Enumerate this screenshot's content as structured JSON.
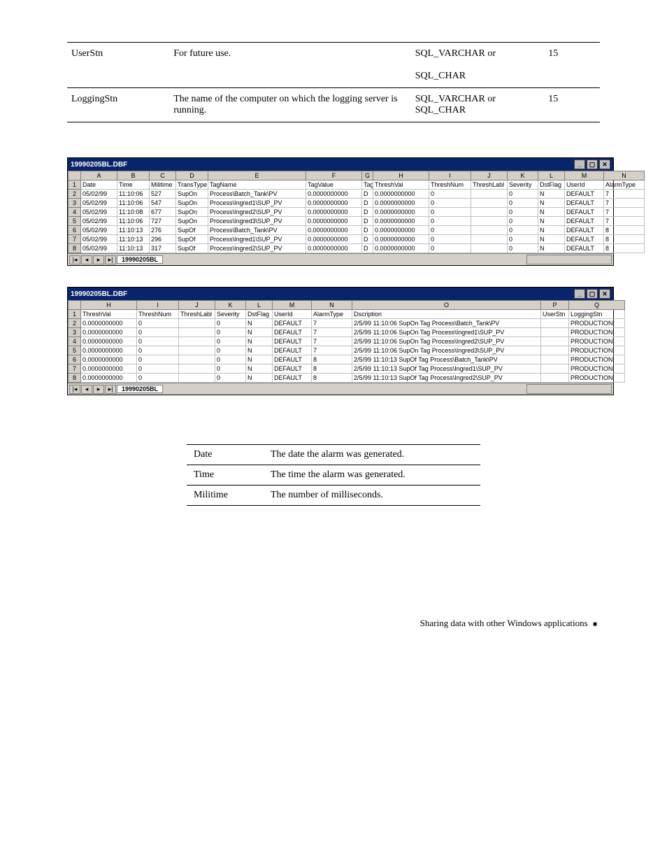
{
  "doc_table_top": {
    "rows": [
      {
        "name": "UserStn",
        "desc": "For future use.",
        "type": "SQL_VARCHAR or\n\nSQL_CHAR",
        "len": "15"
      },
      {
        "name": "LoggingStn",
        "desc": "The name of the computer on which the logging server is running.",
        "type": "SQL_VARCHAR or SQL_CHAR",
        "len": "15"
      }
    ]
  },
  "spreadsheet1": {
    "title": "19990205BL.DBF",
    "col_letters": [
      "",
      "A",
      "B",
      "C",
      "D",
      "E",
      "F",
      "G",
      "H",
      "I",
      "J",
      "K",
      "L",
      "M",
      "N"
    ],
    "header_row": [
      "1",
      "Date",
      "Time",
      "Militime",
      "TransType",
      "TagName",
      "TagValue",
      "TagType",
      "ThreshVal",
      "ThreshNum",
      "ThreshLabl",
      "Severity",
      "DstFlag",
      "UserId",
      "AlarmType"
    ],
    "rows": [
      [
        "2",
        "05/02/99",
        "11:10:06",
        "527",
        "SupOn",
        "Process\\Batch_Tank\\PV",
        "0.0000000000",
        "D",
        "0.0000000000",
        "0",
        "",
        "0",
        "N",
        "DEFAULT",
        "7"
      ],
      [
        "3",
        "05/02/99",
        "11:10:06",
        "547",
        "SupOn",
        "Process\\Ingred1\\SUP_PV",
        "0.0000000000",
        "D",
        "0.0000000000",
        "0",
        "",
        "0",
        "N",
        "DEFAULT",
        "7"
      ],
      [
        "4",
        "05/02/99",
        "11:10:08",
        "677",
        "SupOn",
        "Process\\Ingred2\\SUP_PV",
        "0.0000000000",
        "D",
        "0.0000000000",
        "0",
        "",
        "0",
        "N",
        "DEFAULT",
        "7"
      ],
      [
        "5",
        "05/02/99",
        "11:10:06",
        "727",
        "SupOn",
        "Process\\Ingred3\\SUP_PV",
        "0.0000000000",
        "D",
        "0.0000000000",
        "0",
        "",
        "0",
        "N",
        "DEFAULT",
        "7"
      ],
      [
        "6",
        "05/02/99",
        "11:10:13",
        "276",
        "SupOf",
        "Process\\Batch_Tank\\PV",
        "0.0000000000",
        "D",
        "0.0000000000",
        "0",
        "",
        "0",
        "N",
        "DEFAULT",
        "8"
      ],
      [
        "7",
        "05/02/99",
        "11:10:13",
        "296",
        "SupOf",
        "Process\\Ingred1\\SUP_PV",
        "0.0000000000",
        "D",
        "0.0000000000",
        "0",
        "",
        "0",
        "N",
        "DEFAULT",
        "8"
      ],
      [
        "8",
        "05/02/99",
        "11:10:13",
        "317",
        "SupOf",
        "Process\\Ingred2\\SUP_PV",
        "0.0000000000",
        "D",
        "0.0000000000",
        "0",
        "",
        "0",
        "N",
        "DEFAULT",
        "8"
      ]
    ],
    "tab": "19990205BL"
  },
  "spreadsheet2": {
    "title": "19990205BL.DBF",
    "col_letters": [
      "",
      "H",
      "I",
      "J",
      "K",
      "L",
      "M",
      "N",
      "O",
      "P",
      "Q"
    ],
    "header_row": [
      "1",
      "ThreshVal",
      "ThreshNum",
      "ThreshLabl",
      "Severity",
      "DstFlag",
      "UserId",
      "AlarmType",
      "Dscription",
      "UserStn",
      "LoggingStn"
    ],
    "rows": [
      [
        "2",
        "0.0000000000",
        "0",
        "",
        "0",
        "N",
        "DEFAULT",
        "7",
        "2/5/99     11:10:06 SupOn Tag Process\\Batch_Tank\\PV",
        "",
        "PRODUCTION"
      ],
      [
        "3",
        "0.0000000000",
        "0",
        "",
        "0",
        "N",
        "DEFAULT",
        "7",
        "2/5/99     11:10:06 SupOn Tag Process\\Ingred1\\SUP_PV",
        "",
        "PRODUCTION"
      ],
      [
        "4",
        "0.0000000000",
        "0",
        "",
        "0",
        "N",
        "DEFAULT",
        "7",
        "2/5/99     11:10:06 SupOn Tag Process\\Ingred2\\SUP_PV",
        "",
        "PRODUCTION"
      ],
      [
        "5",
        "0.0000000000",
        "0",
        "",
        "0",
        "N",
        "DEFAULT",
        "7",
        "2/5/99     11:10:06 SupOn Tag Process\\Ingred3\\SUP_PV",
        "",
        "PRODUCTION"
      ],
      [
        "6",
        "0.0000000000",
        "0",
        "",
        "0",
        "N",
        "DEFAULT",
        "8",
        "2/5/99     11:10:13 SupOf Tag Process\\Batch_Tank\\PV",
        "",
        "PRODUCTION"
      ],
      [
        "7",
        "0.0000000000",
        "0",
        "",
        "0",
        "N",
        "DEFAULT",
        "8",
        "2/5/99     11:10:13 SupOf Tag Process\\Ingred1\\SUP_PV",
        "",
        "PRODUCTION"
      ],
      [
        "8",
        "0.0000000000",
        "0",
        "",
        "0",
        "N",
        "DEFAULT",
        "8",
        "2/5/99     11:10:13 SupOf Tag Process\\Ingred2\\SUP_PV",
        "",
        "PRODUCTION"
      ]
    ],
    "tab": "19990205BL"
  },
  "doc_table_bottom": {
    "rows": [
      {
        "name": "Date",
        "desc": "The date the alarm was generated."
      },
      {
        "name": "Time",
        "desc": "The time the alarm was generated."
      },
      {
        "name": "Militime",
        "desc": "The number of milliseconds."
      }
    ]
  },
  "footer": "Sharing data with other Windows applications",
  "win_controls": {
    "min": "_",
    "max": "▢",
    "close": "✕"
  }
}
